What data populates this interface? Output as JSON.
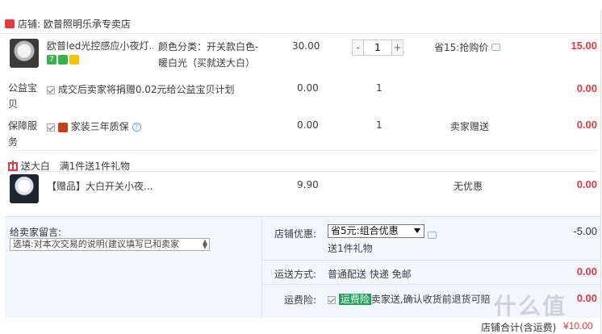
{
  "shop": {
    "label": "店铺:",
    "name": "欧普照明乐承专卖店"
  },
  "item1": {
    "title": "欧普led光控感应小夜灯...",
    "badge_seven": "7",
    "sku_line1": "颜色分类：开关款白色-",
    "sku_line2": "暖白光（买就送大白）",
    "unit_price": "30.00",
    "quantity": "1",
    "qty_minus": "-",
    "qty_plus": "+",
    "discount": "省15:抢购价",
    "subtotal": "15.00"
  },
  "service_welfare": {
    "label_line1": "公益宝",
    "label_line2": "贝",
    "text": "成交后卖家将捐赠0.02元给公益宝贝计划",
    "price": "0.00",
    "quantity": "1",
    "subtotal": "0.00"
  },
  "service_warranty": {
    "label_line1": "保障服",
    "label_line2": "务",
    "text": "家装三年质保",
    "price": "0.00",
    "quantity": "1",
    "discount": "卖家赠送",
    "subtotal": "0.00"
  },
  "gift_promo": {
    "tag": "送大白",
    "text": "满1件送1件礼物"
  },
  "gift_item": {
    "title": "【赠品】大白开关小夜...",
    "price": "9.90",
    "discount": "无优惠",
    "subtotal": "0.00"
  },
  "memo": {
    "label": "给卖家留言:",
    "placeholder": "选填:对本次交易的说明(建议填写已和卖家"
  },
  "shop_promo": {
    "label": "店铺优惠:",
    "selected": "省5元:组合优惠",
    "gift_note": "送1件礼物",
    "amount": "-5.00"
  },
  "shipping": {
    "label": "运送方式:",
    "value": "普通配送 快递 免邮",
    "amount": "0.00"
  },
  "insurance": {
    "label": "运费险:",
    "tag": "运费险",
    "text": "卖家送,确认收货前退货可赔",
    "amount": "0.00"
  },
  "total": {
    "label": "店铺合计(含运费)",
    "currency": "¥",
    "amount": "10.00"
  },
  "watermark": "什么值",
  "colors": {
    "accent_red": "#e4393c",
    "panel_blue": "#f2f7fd",
    "insurance_green": "#24a05a"
  }
}
